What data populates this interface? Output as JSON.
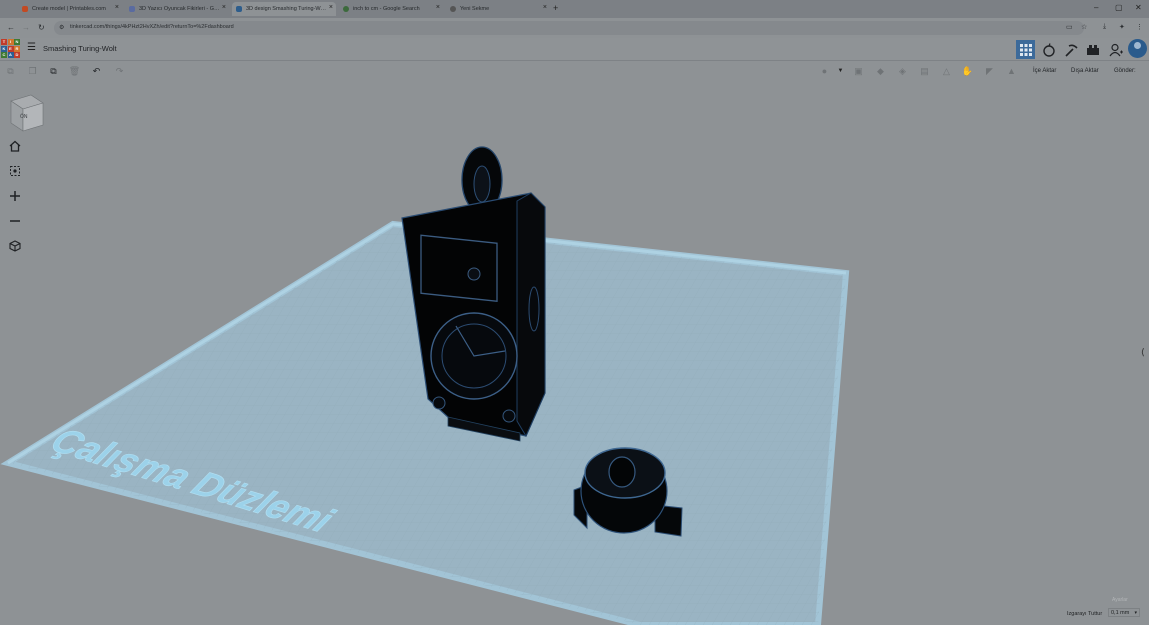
{
  "browser": {
    "tabs": [
      {
        "label": "Create model | Printables.com",
        "active": false,
        "favicon_color": "#c24a23"
      },
      {
        "label": "3D Yazıcı Oyuncak Fikirleri - G…",
        "active": false,
        "favicon_color": "#5a6ba0"
      },
      {
        "label": "3D design Smashing Turing-W…",
        "active": true,
        "favicon_color": "#2d5d8c"
      },
      {
        "label": "inch to cm - Google Search",
        "active": false,
        "favicon_color": "#3c6a3c"
      },
      {
        "label": "Yeni Sekme",
        "active": false,
        "favicon_color": "#555"
      }
    ],
    "new_tab_glyph": "+",
    "close_glyph": "×",
    "url": "tinkercad.com/things/4kPHzt2HvXZh/edit?returnTo=%2Fdashboard"
  },
  "app": {
    "logo_letters": [
      "T",
      "I",
      "N",
      "K",
      "E",
      "R",
      "C",
      "A",
      "D"
    ],
    "logo_colors": [
      "#c13c2a",
      "#d1762e",
      "#3f7a33",
      "#2c5f95",
      "#c13c2a",
      "#d1762e",
      "#3f7a33",
      "#2c5f95",
      "#c13c2a"
    ],
    "design_title": "Smashing Turing-Wolt",
    "import_label": "İçe Aktar",
    "export_label": "Dışa Aktar",
    "send_label": "Gönder:"
  },
  "workspace": {
    "viewcube_face": "ÖN",
    "workplane_label": "Çalışma Düzlemi",
    "settings_label": "Ayarlar",
    "snap_grid_label": "Izgarayı Tuttur",
    "snap_grid_value": "0,1 mm"
  }
}
